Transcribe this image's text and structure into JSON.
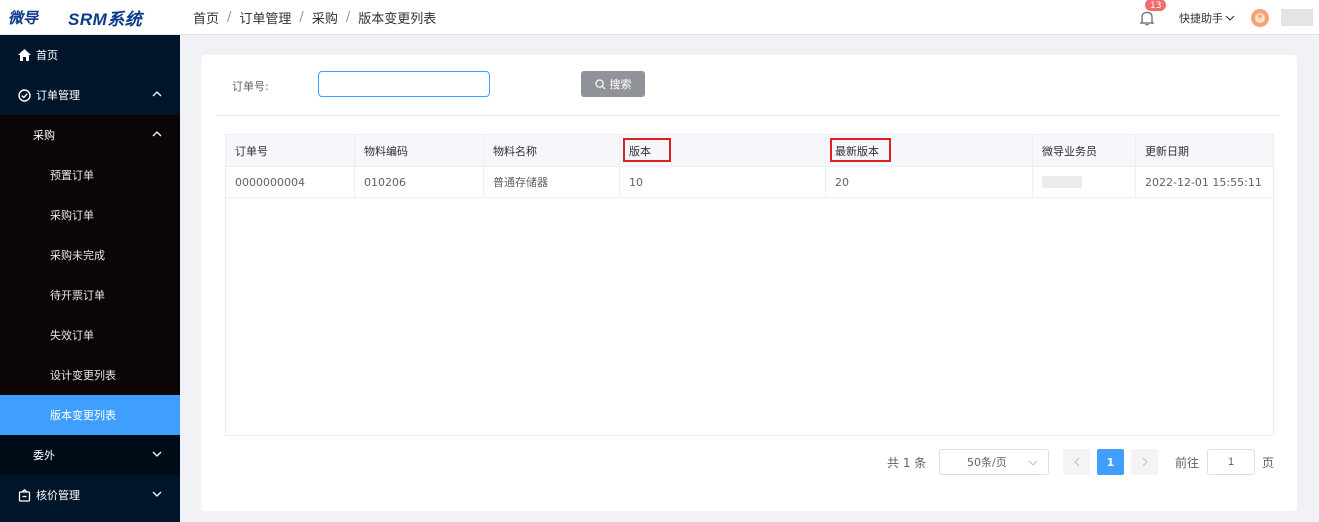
{
  "logo": {
    "mark": "微导",
    "title": "SRM系统"
  },
  "sidebar": {
    "home": "首页",
    "order_mgmt": "订单管理",
    "purchase": "采购",
    "purchase_items": [
      "预置订单",
      "采购订单",
      "采购未完成",
      "待开票订单",
      "失效订单",
      "设计变更列表",
      "版本变更列表"
    ],
    "outsource": "委外",
    "price_mgmt": "核价管理"
  },
  "breadcrumb": [
    "首页",
    "订单管理",
    "采购",
    "版本变更列表"
  ],
  "header": {
    "notification_count": "13",
    "quick_helper": "快捷助手"
  },
  "search": {
    "label": "订单号:",
    "value": "",
    "button": "搜索"
  },
  "table": {
    "columns": [
      "订单号",
      "物料编码",
      "物料名称",
      "版本",
      "最新版本",
      "微导业务员",
      "更新日期"
    ],
    "rows": [
      [
        "0000000004",
        "010206",
        "普通存储器",
        "10",
        "20",
        "",
        "2022-12-01 15:55:11"
      ]
    ]
  },
  "pagination": {
    "total": "共 1 条",
    "page_size": "50条/页",
    "current_page": "1",
    "goto_label": "前往",
    "goto_value": "1",
    "page_suffix": "页"
  },
  "colors": {
    "accent": "#409eff",
    "sidebar_bg": "#001529",
    "highlight": "#e02020"
  }
}
